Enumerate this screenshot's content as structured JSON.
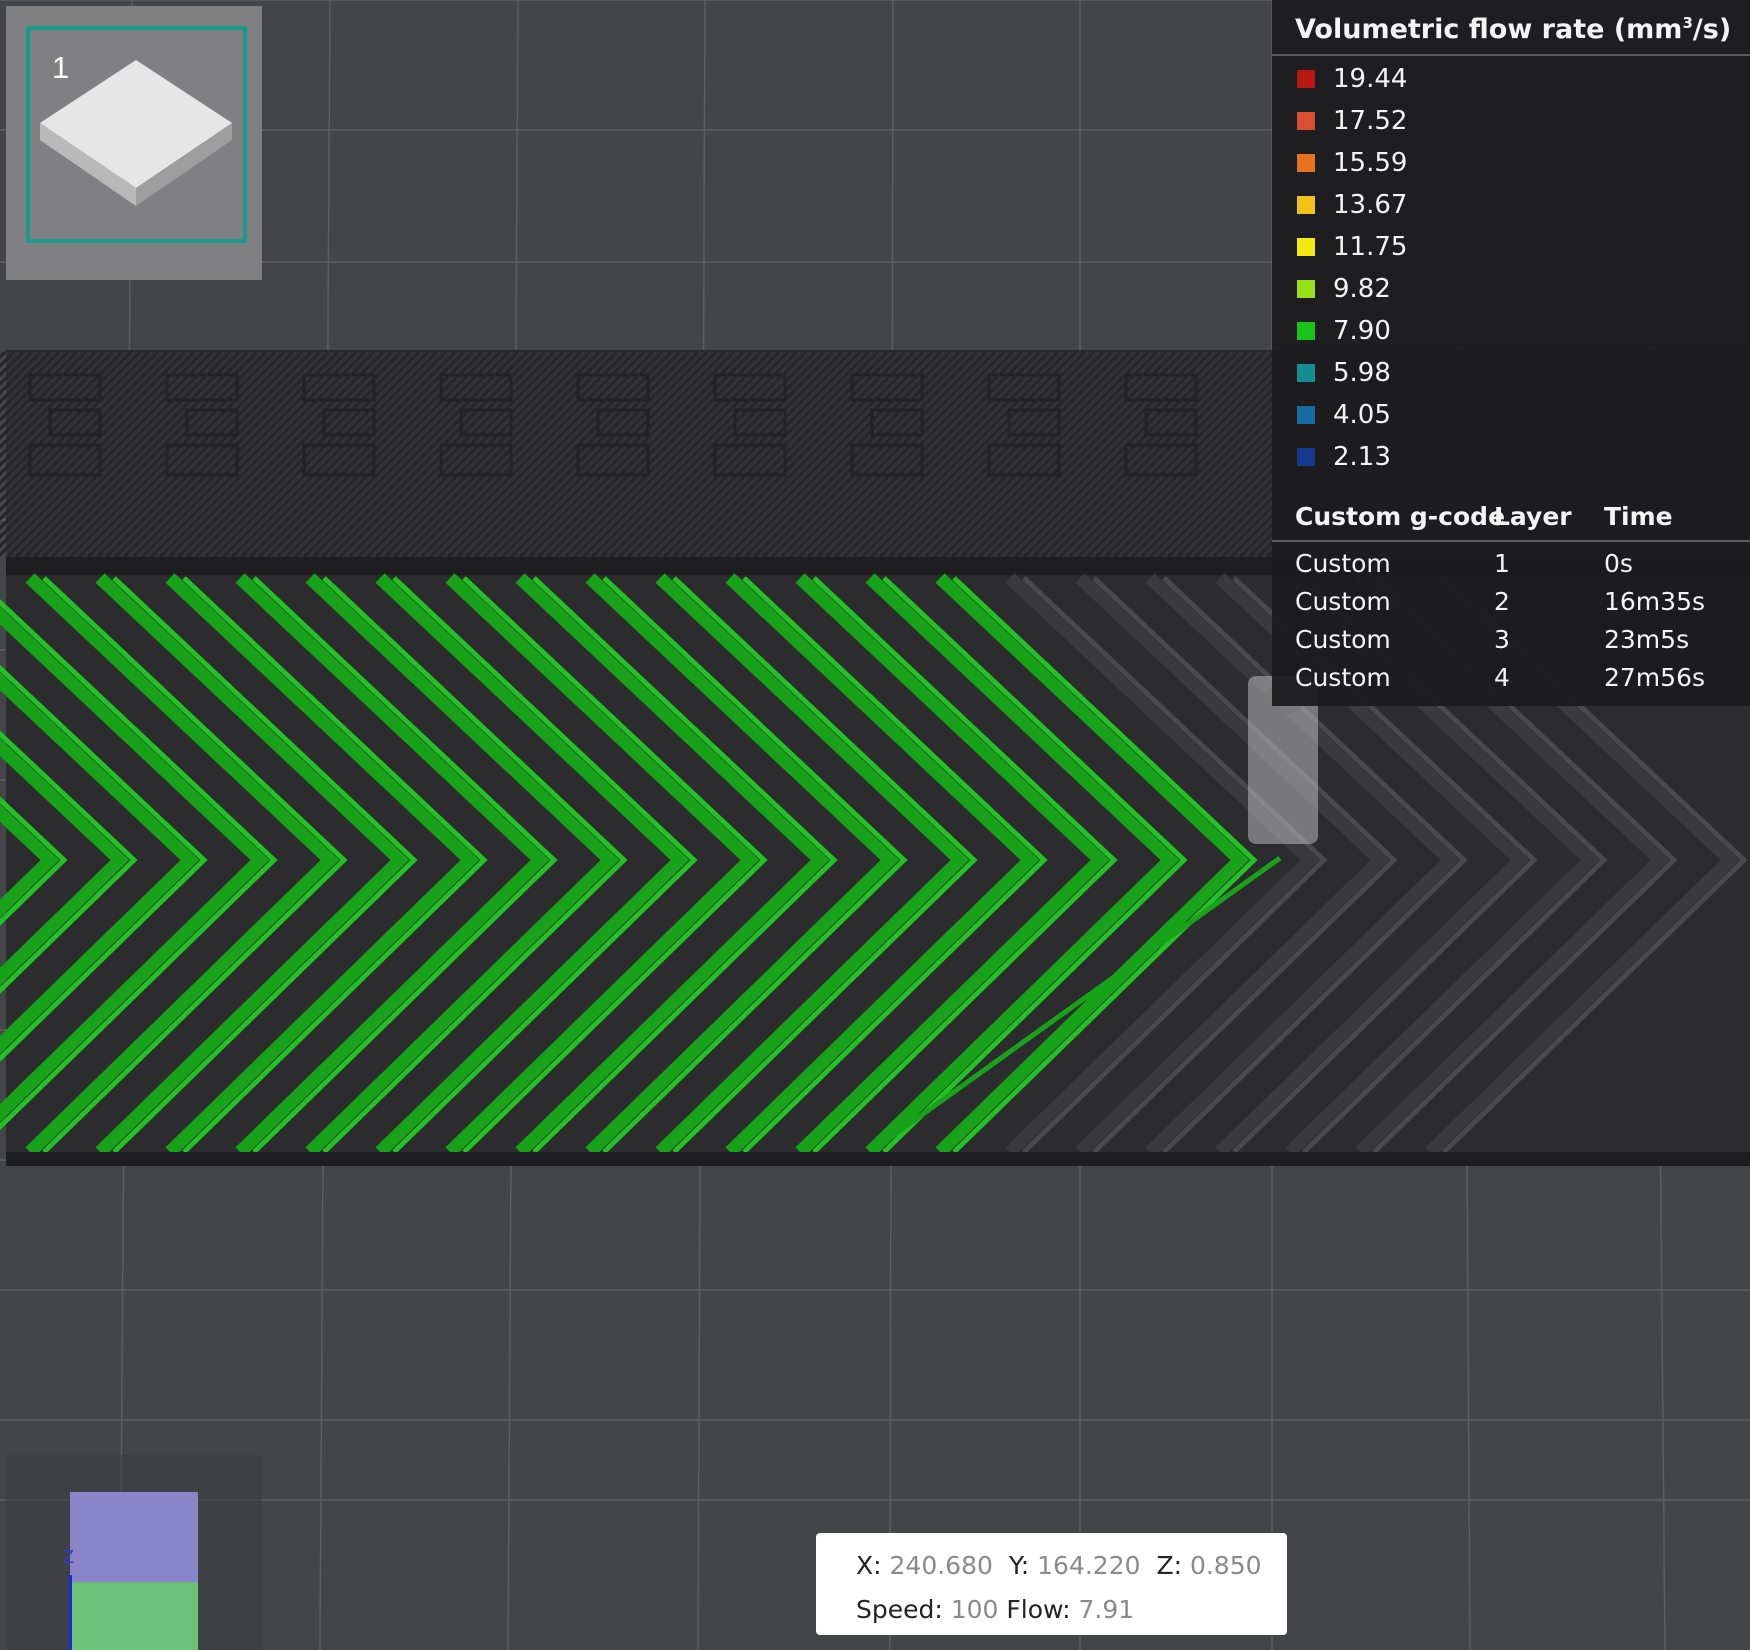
{
  "plate": {
    "index": "1"
  },
  "legend": {
    "title": "Volumetric flow rate (mm",
    "title_sup": "3",
    "title_suffix": "/s)",
    "items": [
      {
        "value": "19.44",
        "color": "#b41a12"
      },
      {
        "value": "17.52",
        "color": "#d94f34"
      },
      {
        "value": "15.59",
        "color": "#e8711c"
      },
      {
        "value": "13.67",
        "color": "#f2c21a"
      },
      {
        "value": "11.75",
        "color": "#f3ea12"
      },
      {
        "value": "9.82",
        "color": "#95e018"
      },
      {
        "value": "7.90",
        "color": "#18c41a"
      },
      {
        "value": "5.98",
        "color": "#138e92"
      },
      {
        "value": "4.05",
        "color": "#166b9f"
      },
      {
        "value": "2.13",
        "color": "#153a8c"
      }
    ]
  },
  "gcode_table": {
    "headers": [
      "Custom g-code",
      "Layer",
      "Time"
    ],
    "rows": [
      {
        "code": "Custom",
        "layer": "1",
        "time": "0s"
      },
      {
        "code": "Custom",
        "layer": "2",
        "time": "16m35s"
      },
      {
        "code": "Custom",
        "layer": "3",
        "time": "23m5s"
      },
      {
        "code": "Custom",
        "layer": "4",
        "time": "27m56s"
      }
    ]
  },
  "position": {
    "x_label": "X:",
    "x": "240.680",
    "y_label": "Y:",
    "y": "164.220",
    "z_label": "Z:",
    "z": "0.850",
    "speed_label": "Speed:",
    "speed": "100",
    "flow_label": "Flow:",
    "flow": "7.91"
  },
  "gizmo": {
    "axis_label": "Z"
  },
  "colors": {
    "extrusion_active": "#18a21a",
    "extrusion_inactive": "#2c2c2e",
    "bed": "#444548",
    "accent": "#1a9a8c"
  }
}
